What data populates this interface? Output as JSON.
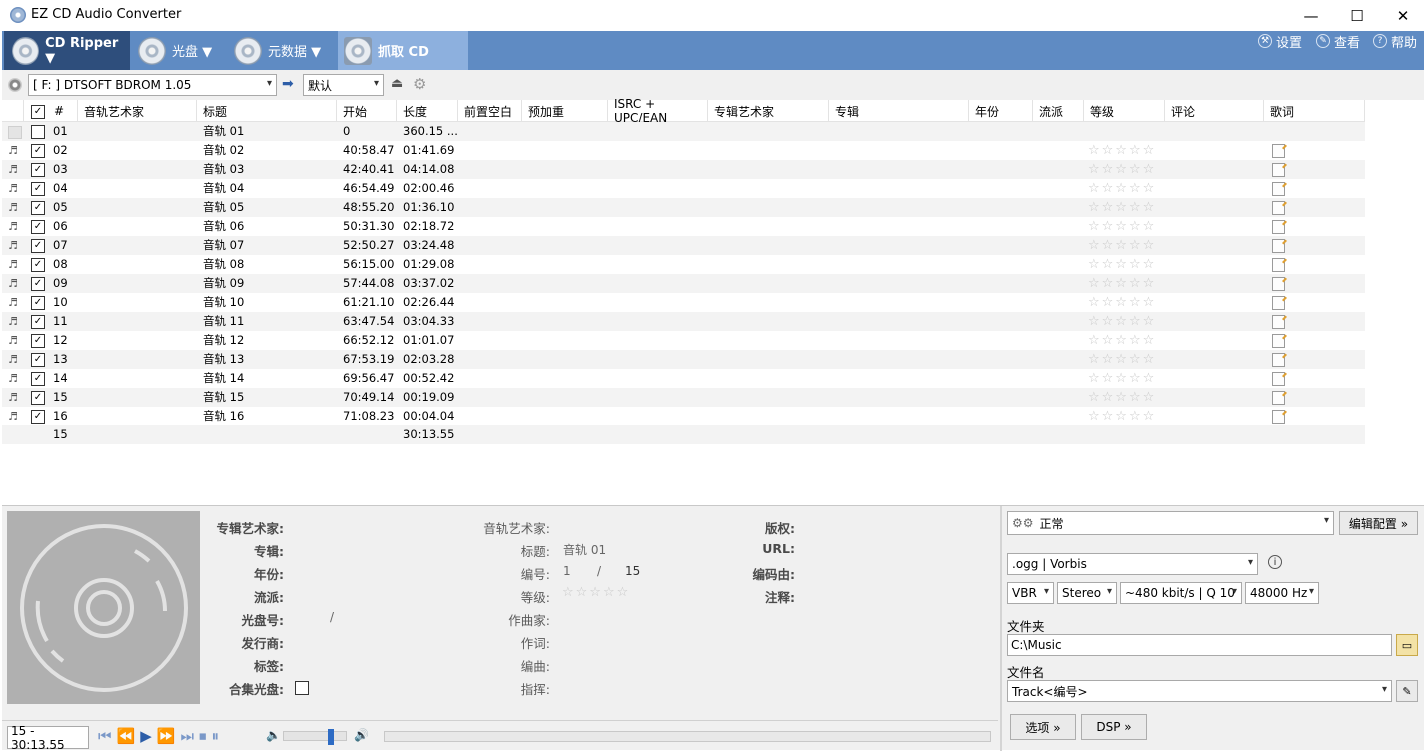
{
  "window": {
    "title": "EZ CD Audio Converter",
    "minimize": "—",
    "maximize": "☐",
    "close": "✕"
  },
  "ribbon": {
    "cd_ripper": "CD Ripper ▼",
    "disc": "光盘 ▼",
    "metadata": "元数据 ▼",
    "grab_cd": "抓取 CD",
    "settings": "设置",
    "view": "查看",
    "help": "帮助"
  },
  "toolbar": {
    "drive": "[ F: ] DTSOFT BDROM 1.05",
    "profile": "默认"
  },
  "columns": [
    "#",
    "音轨艺术家",
    "标题",
    "开始",
    "长度",
    "前置空白",
    "预加重",
    "ISRC + UPC/EAN",
    "专辑艺术家",
    "专辑",
    "年份",
    "流派",
    "等级",
    "评论",
    "歌词"
  ],
  "tracks": [
    {
      "no": "01",
      "title": "音轨 01",
      "start": "0",
      "length": "360.15 ...",
      "checked": false,
      "audio": false
    },
    {
      "no": "02",
      "title": "音轨 02",
      "start": "40:58.47",
      "length": "01:41.69",
      "checked": true,
      "audio": true
    },
    {
      "no": "03",
      "title": "音轨 03",
      "start": "42:40.41",
      "length": "04:14.08",
      "checked": true,
      "audio": true
    },
    {
      "no": "04",
      "title": "音轨 04",
      "start": "46:54.49",
      "length": "02:00.46",
      "checked": true,
      "audio": true
    },
    {
      "no": "05",
      "title": "音轨 05",
      "start": "48:55.20",
      "length": "01:36.10",
      "checked": true,
      "audio": true
    },
    {
      "no": "06",
      "title": "音轨 06",
      "start": "50:31.30",
      "length": "02:18.72",
      "checked": true,
      "audio": true
    },
    {
      "no": "07",
      "title": "音轨 07",
      "start": "52:50.27",
      "length": "03:24.48",
      "checked": true,
      "audio": true
    },
    {
      "no": "08",
      "title": "音轨 08",
      "start": "56:15.00",
      "length": "01:29.08",
      "checked": true,
      "audio": true
    },
    {
      "no": "09",
      "title": "音轨 09",
      "start": "57:44.08",
      "length": "03:37.02",
      "checked": true,
      "audio": true
    },
    {
      "no": "10",
      "title": "音轨 10",
      "start": "61:21.10",
      "length": "02:26.44",
      "checked": true,
      "audio": true
    },
    {
      "no": "11",
      "title": "音轨 11",
      "start": "63:47.54",
      "length": "03:04.33",
      "checked": true,
      "audio": true
    },
    {
      "no": "12",
      "title": "音轨 12",
      "start": "66:52.12",
      "length": "01:01.07",
      "checked": true,
      "audio": true
    },
    {
      "no": "13",
      "title": "音轨 13",
      "start": "67:53.19",
      "length": "02:03.28",
      "checked": true,
      "audio": true
    },
    {
      "no": "14",
      "title": "音轨 14",
      "start": "69:56.47",
      "length": "00:52.42",
      "checked": true,
      "audio": true
    },
    {
      "no": "15",
      "title": "音轨 15",
      "start": "70:49.14",
      "length": "00:19.09",
      "checked": true,
      "audio": true
    },
    {
      "no": "16",
      "title": "音轨 16",
      "start": "71:08.23",
      "length": "00:04.04",
      "checked": true,
      "audio": true
    }
  ],
  "summary": {
    "count": "15",
    "total": "30:13.55"
  },
  "stars": "☆☆☆☆☆",
  "album": {
    "album_artist": "专辑艺术家:",
    "album": "专辑:",
    "year": "年份:",
    "genre": "流派:",
    "disc_no": "光盘号:",
    "disc_sep": "/",
    "publisher": "发行商:",
    "tags": "标签:",
    "compilation": "合集光盘:"
  },
  "track_info": {
    "artist": "音轨艺术家:",
    "title": "标题:",
    "title_value": "音轨 01",
    "number": "编号:",
    "number_value": "1",
    "number_sep": "/",
    "number_total": "15",
    "rating": "等级:",
    "composer": "作曲家:",
    "lyricist": "作词:",
    "arranger": "编曲:",
    "conductor": "指挥:"
  },
  "rights": {
    "copyright": "版权:",
    "url": "URL:",
    "encoded_by": "编码由:",
    "comment": "注释:"
  },
  "encoder": {
    "preset": "正常",
    "edit_config": "编辑配置 »",
    "format": ".ogg  |  Vorbis",
    "mode": "VBR",
    "channels": "Stereo",
    "quality": "~480 kbit/s | Q 10",
    "rate": "48000 Hz",
    "folder_label": "文件夹",
    "folder": "C:\\Music",
    "filename_label": "文件名",
    "filename": "Track<编号>",
    "options": "选项 »",
    "dsp": "DSP »"
  },
  "player": {
    "position": "15 - 30:13.55",
    "volume": 0.75
  }
}
